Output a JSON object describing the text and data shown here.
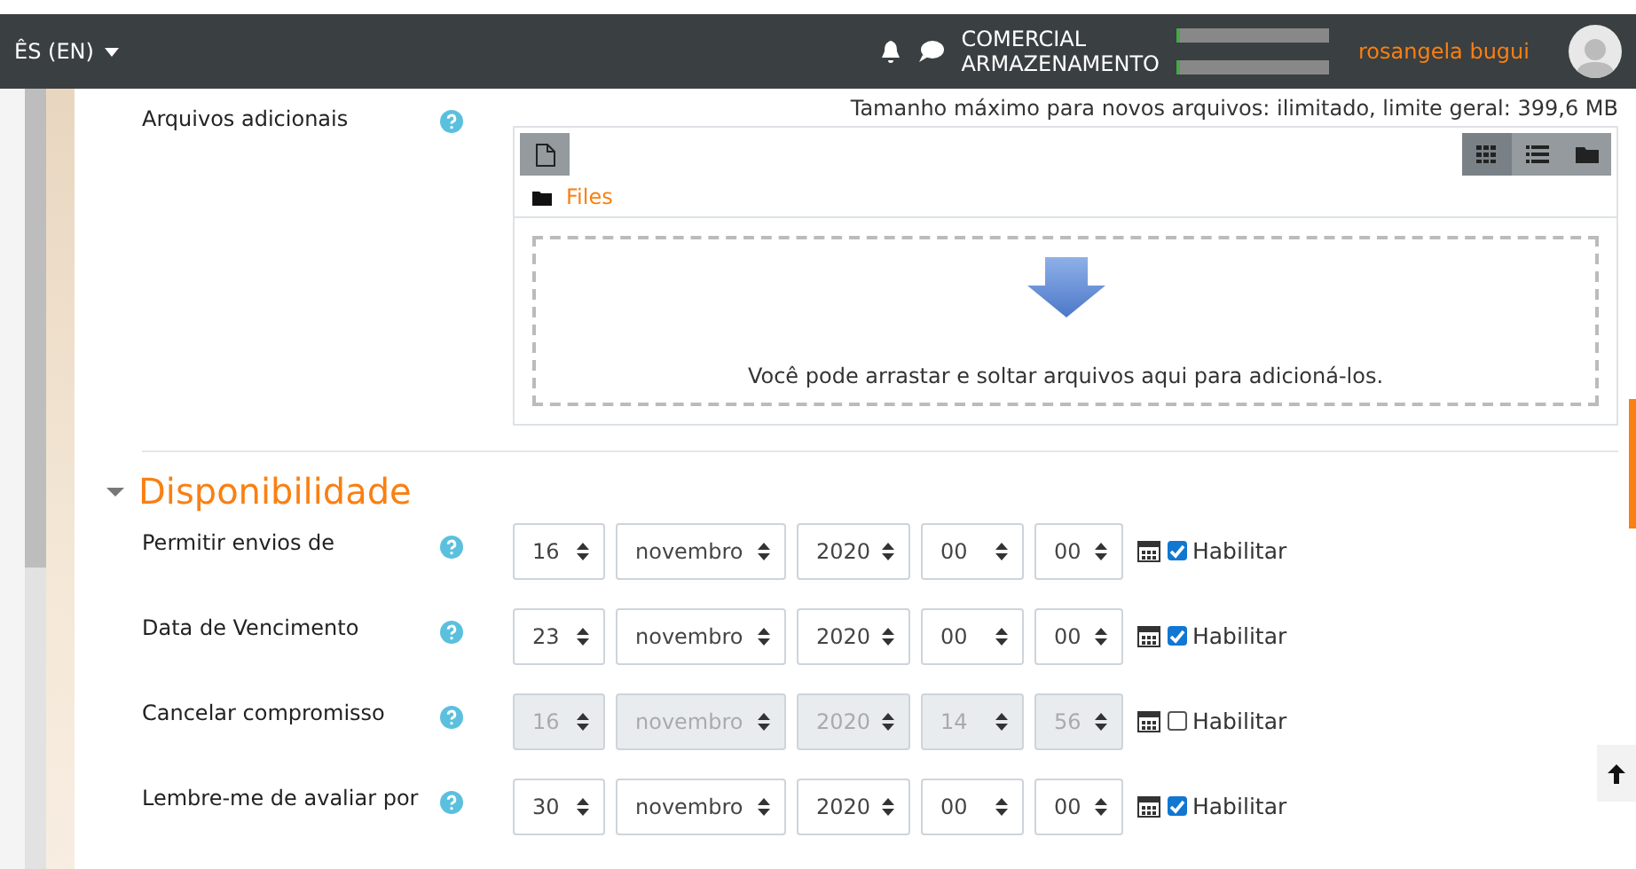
{
  "navbar": {
    "language": "ÊS (EN)",
    "site_lines": [
      "COMERCIAL",
      "ARMAZENAMENTO"
    ],
    "user_name": "rosangela bugui"
  },
  "files_field": {
    "label": "Arquivos adicionais",
    "limit_text": "Tamanho máximo para novos arquivos: ilimitado, limite geral: 399,6 MB",
    "view_buttons": [
      {
        "kind": "grid",
        "selected": true
      },
      {
        "kind": "list",
        "selected": false
      },
      {
        "kind": "tree",
        "selected": false
      }
    ],
    "folder": "Files",
    "drop_text": "Você pode arrastar e soltar arquivos aqui para adicioná-los."
  },
  "section": {
    "title": "Disponibilidade",
    "expanded": true
  },
  "date_fields": [
    {
      "label": "Permitir envios de",
      "day": "16",
      "month": "novembro",
      "year": "2020",
      "hour": "00",
      "minute": "00",
      "enable_label": "Habilitar",
      "checked": true
    },
    {
      "label": "Data de Vencimento",
      "day": "23",
      "month": "novembro",
      "year": "2020",
      "hour": "00",
      "minute": "00",
      "enable_label": "Habilitar",
      "checked": true
    },
    {
      "label": "Cancelar compromisso",
      "day": "16",
      "month": "novembro",
      "year": "2020",
      "hour": "14",
      "minute": "56",
      "enable_label": "Habilitar",
      "checked": false
    },
    {
      "label": "Lembre-me de avaliar por",
      "day": "30",
      "month": "novembro",
      "year": "2020",
      "hour": "00",
      "minute": "00",
      "enable_label": "Habilitar",
      "checked": true
    }
  ]
}
